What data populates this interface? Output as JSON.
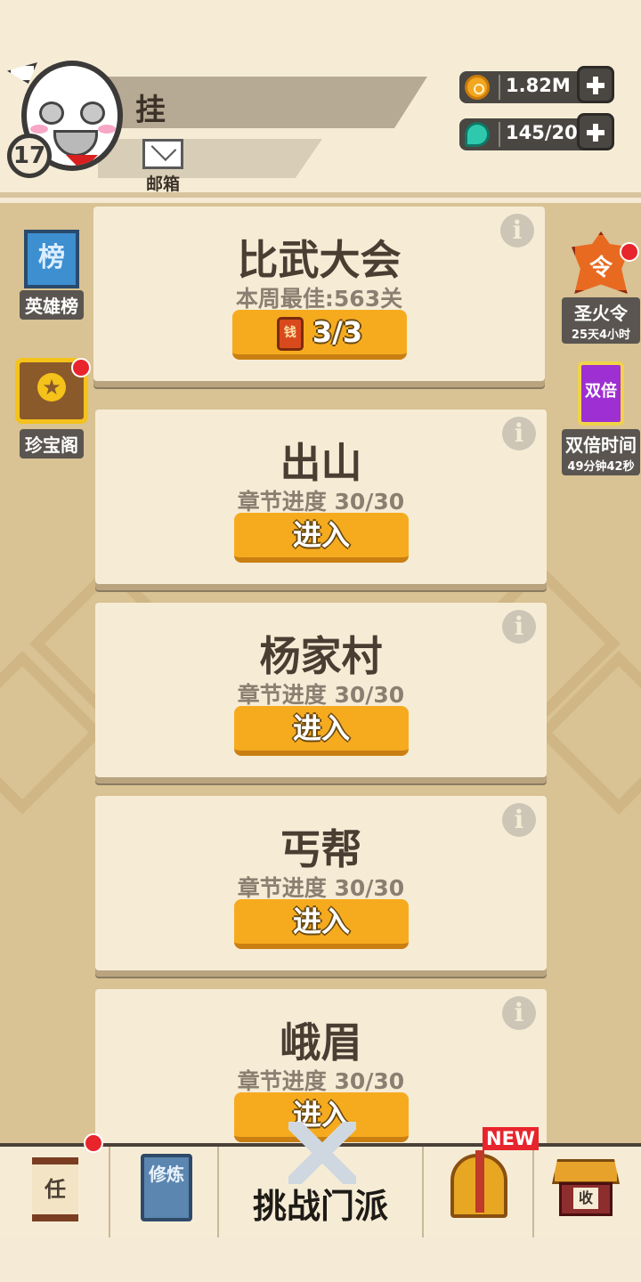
{
  "player": {
    "name": "挂",
    "level": "17",
    "mail_label": "邮箱"
  },
  "resources": {
    "gold": "1.82M",
    "gem": "145/20"
  },
  "side_left": {
    "ranking": {
      "icon_text": "榜",
      "label": "英雄榜"
    },
    "treasure": {
      "label": "珍宝阁"
    }
  },
  "side_right": {
    "torch": {
      "icon_text": "令",
      "label": "圣火令",
      "timer": "25天4小时"
    },
    "double": {
      "icon_text": "双倍",
      "label": "双倍时间",
      "timer": "49分钟42秒"
    }
  },
  "cards": [
    {
      "title": "比武大会",
      "subtitle": "本周最佳:563关",
      "button": "3/3",
      "ticket": "钱"
    },
    {
      "title": "出山",
      "subtitle": "章节进度 30/30",
      "button": "进入"
    },
    {
      "title": "杨家村",
      "subtitle": "章节进度 30/30",
      "button": "进入"
    },
    {
      "title": "丐帮",
      "subtitle": "章节进度 30/30",
      "button": "进入"
    },
    {
      "title": "峨眉",
      "subtitle": "章节进度 30/30",
      "button": "进入"
    }
  ],
  "info_glyph": "i",
  "nav": {
    "task_icon": "任",
    "train_icon": "修炼",
    "challenge_label": "挑战门派",
    "new_tag": "NEW",
    "collect_icon": "收"
  },
  "colors": {
    "accent_button": "#f6ab1f",
    "card_bg": "#f6ecd6",
    "badge_red": "#e8242c"
  }
}
